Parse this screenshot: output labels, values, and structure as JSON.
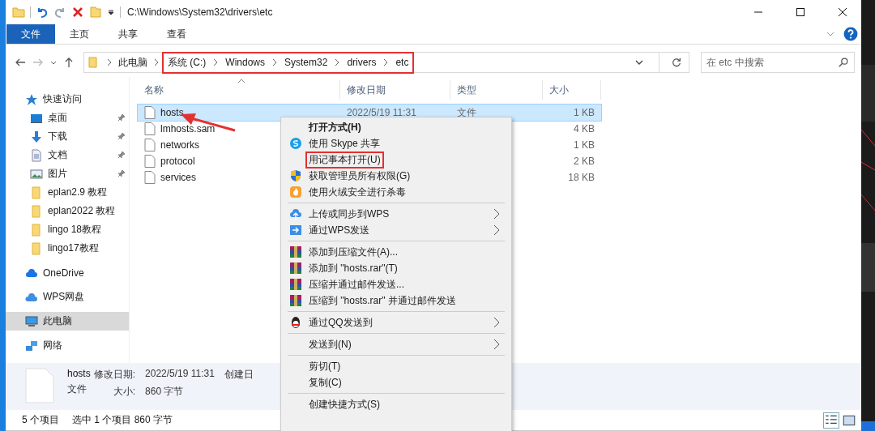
{
  "title_bar": {
    "path": "C:\\Windows\\System32\\drivers\\etc"
  },
  "ribbon_tabs": [
    {
      "label": "文件",
      "selected": true
    },
    {
      "label": "主页",
      "selected": false
    },
    {
      "label": "共享",
      "selected": false
    },
    {
      "label": "查看",
      "selected": false
    }
  ],
  "address": {
    "crumbs": [
      "此电脑"
    ],
    "boxed_crumbs": [
      "系统 (C:)",
      "Windows",
      "System32",
      "drivers",
      "etc"
    ]
  },
  "search": {
    "placeholder": "在 etc 中搜索"
  },
  "columns": [
    "名称",
    "修改日期",
    "类型",
    "大小"
  ],
  "files": [
    {
      "name": "hosts",
      "date": "2022/5/19 11:31",
      "type": "文件",
      "size": "1 KB",
      "selected": true
    },
    {
      "name": "lmhosts.sam",
      "size": "4 KB",
      "selected": false
    },
    {
      "name": "networks",
      "size": "1 KB",
      "selected": false
    },
    {
      "name": "protocol",
      "size": "2 KB",
      "selected": false
    },
    {
      "name": "services",
      "size": "18 KB",
      "selected": false
    }
  ],
  "sidebar": [
    {
      "label": "快速访问",
      "kind": "star",
      "selected": false,
      "children": [
        {
          "label": "桌面",
          "kind": "desktop",
          "pinned": true
        },
        {
          "label": "下载",
          "kind": "download",
          "pinned": true
        },
        {
          "label": "文档",
          "kind": "document",
          "pinned": true
        },
        {
          "label": "图片",
          "kind": "pictures",
          "pinned": true
        },
        {
          "label": "eplan2.9 教程",
          "kind": "folder",
          "pinned": false
        },
        {
          "label": "eplan2022 教程",
          "kind": "folder",
          "pinned": false
        },
        {
          "label": "lingo 18教程",
          "kind": "folder",
          "pinned": false
        },
        {
          "label": "lingo17教程",
          "kind": "folder",
          "pinned": false
        }
      ]
    },
    {
      "label": "OneDrive",
      "kind": "cloud",
      "selected": false
    },
    {
      "label": "WPS网盘",
      "kind": "wpscloud",
      "selected": false
    },
    {
      "label": "此电脑",
      "kind": "computer",
      "selected": true
    },
    {
      "label": "网络",
      "kind": "network",
      "selected": false
    }
  ],
  "context_menu": [
    {
      "kind": "plain",
      "label": "打开方式(H)",
      "bold": true,
      "boxed": false,
      "submenu": false
    },
    {
      "kind": "skype",
      "label": "使用 Skype 共享",
      "bold": false,
      "boxed": false,
      "submenu": false
    },
    {
      "kind": "plain",
      "label": "用记事本打开(U)",
      "bold": false,
      "boxed": true,
      "submenu": false
    },
    {
      "kind": "shield",
      "label": "获取管理员所有权限(G)",
      "bold": false,
      "boxed": false,
      "submenu": false
    },
    {
      "kind": "flame",
      "label": "使用火绒安全进行杀毒",
      "bold": false,
      "boxed": false,
      "submenu": false
    },
    {
      "kind": "separator"
    },
    {
      "kind": "upload",
      "label": "上传或同步到WPS",
      "bold": false,
      "boxed": false,
      "submenu": true
    },
    {
      "kind": "send",
      "label": "通过WPS发送",
      "bold": false,
      "boxed": false,
      "submenu": true
    },
    {
      "kind": "separator"
    },
    {
      "kind": "archive",
      "label": "添加到压缩文件(A)...",
      "bold": false,
      "boxed": false,
      "submenu": false
    },
    {
      "kind": "archive",
      "label": "添加到 \"hosts.rar\"(T)",
      "bold": false,
      "boxed": false,
      "submenu": false
    },
    {
      "kind": "archive",
      "label": "压缩并通过邮件发送...",
      "bold": false,
      "boxed": false,
      "submenu": false
    },
    {
      "kind": "archive",
      "label": "压缩到 \"hosts.rar\" 并通过邮件发送",
      "bold": false,
      "boxed": false,
      "submenu": false
    },
    {
      "kind": "separator"
    },
    {
      "kind": "penguin",
      "label": "通过QQ发送到",
      "bold": false,
      "boxed": false,
      "submenu": true
    },
    {
      "kind": "separator"
    },
    {
      "kind": "plain",
      "label": "发送到(N)",
      "bold": false,
      "boxed": false,
      "submenu": true
    },
    {
      "kind": "separator"
    },
    {
      "kind": "plain",
      "label": "剪切(T)",
      "bold": false,
      "boxed": false,
      "submenu": false
    },
    {
      "kind": "plain",
      "label": "复制(C)",
      "bold": false,
      "boxed": false,
      "submenu": false
    },
    {
      "kind": "separator"
    },
    {
      "kind": "plain",
      "label": "创建快捷方式(S)",
      "bold": false,
      "boxed": false,
      "submenu": false
    }
  ],
  "details": {
    "name": "hosts",
    "type": "文件",
    "fields": [
      {
        "label": "修改日期:",
        "value": "2022/5/19 11:31"
      },
      {
        "label": "大小:",
        "value": "860 字节"
      }
    ],
    "cut_label": "创建日"
  },
  "status_bar": [
    "5 个项目",
    "选中 1 个项目  860 字节"
  ]
}
